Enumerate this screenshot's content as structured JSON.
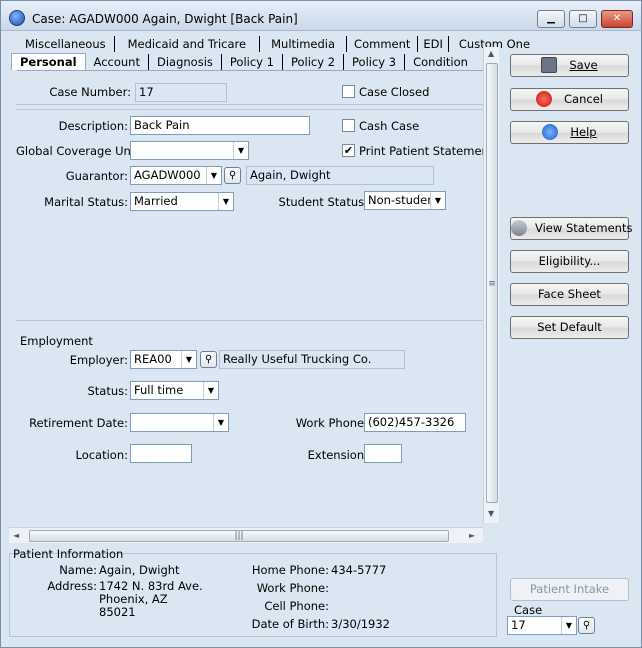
{
  "window": {
    "title": "Case: AGADW000 Again, Dwight  [Back Pain]",
    "controls": {
      "minimize": "▁",
      "maximize": "□",
      "close": "✕"
    }
  },
  "tabs": {
    "row1": [
      "Miscellaneous",
      "Medicaid and Tricare",
      "Multimedia",
      "Comment",
      "EDI",
      "Custom One"
    ],
    "row2": [
      "Personal",
      "Account",
      "Diagnosis",
      "Policy 1",
      "Policy 2",
      "Policy 3",
      "Condition"
    ],
    "active": "Personal"
  },
  "case": {
    "number_label": "Case Number:",
    "number_value": "17",
    "closed_label": "Case Closed",
    "closed_checked": false
  },
  "details": {
    "description_label": "Description:",
    "description_value": "Back Pain",
    "cash_case_label": "Cash Case",
    "cash_case_checked": false,
    "global_coverage_label": "Global Coverage Until:",
    "global_coverage_value": "",
    "print_statement_label": "Print Patient Statement",
    "print_statement_checked": true,
    "guarantor_label": "Guarantor:",
    "guarantor_value": "AGADW000",
    "guarantor_name": "Again, Dwight",
    "marital_label": "Marital Status:",
    "marital_value": "Married",
    "student_label": "Student Status:",
    "student_value": "Non-student"
  },
  "employment": {
    "heading": "Employment",
    "employer_label": "Employer:",
    "employer_value": "REA00",
    "employer_name": "Really Useful Trucking Co.",
    "status_label": "Status:",
    "status_value": "Full time",
    "retirement_label": "Retirement Date:",
    "retirement_value": "",
    "work_phone_label": "Work Phone:",
    "work_phone_value": "(602)457-3326",
    "location_label": "Location:",
    "location_value": "",
    "extension_label": "Extension:",
    "extension_value": ""
  },
  "buttons": {
    "save": "Save",
    "cancel": "Cancel",
    "help": "Help",
    "view_statements": "View Statements",
    "eligibility": "Eligibility...",
    "face_sheet": "Face Sheet",
    "set_default": "Set Default",
    "patient_intake": "Patient Intake"
  },
  "case_selector": {
    "label": "Case",
    "value": "17"
  },
  "patient_info": {
    "heading": "Patient Information",
    "name_label": "Name:",
    "name_value": "Again, Dwight",
    "address_label": "Address:",
    "address_line1": "1742 N. 83rd Ave.",
    "address_line2": "Phoenix, AZ",
    "address_line3": "85021",
    "home_phone_label": "Home Phone:",
    "home_phone_value": "434-5777",
    "work_phone_label": "Work Phone:",
    "work_phone_value": "",
    "cell_phone_label": "Cell Phone:",
    "cell_phone_value": "",
    "dob_label": "Date of Birth:",
    "dob_value": "3/30/1932"
  },
  "scroll": {
    "grip": "≡",
    "hgrip": "|||",
    "up": "▲",
    "down": "▼",
    "left": "◄",
    "right": "►"
  }
}
